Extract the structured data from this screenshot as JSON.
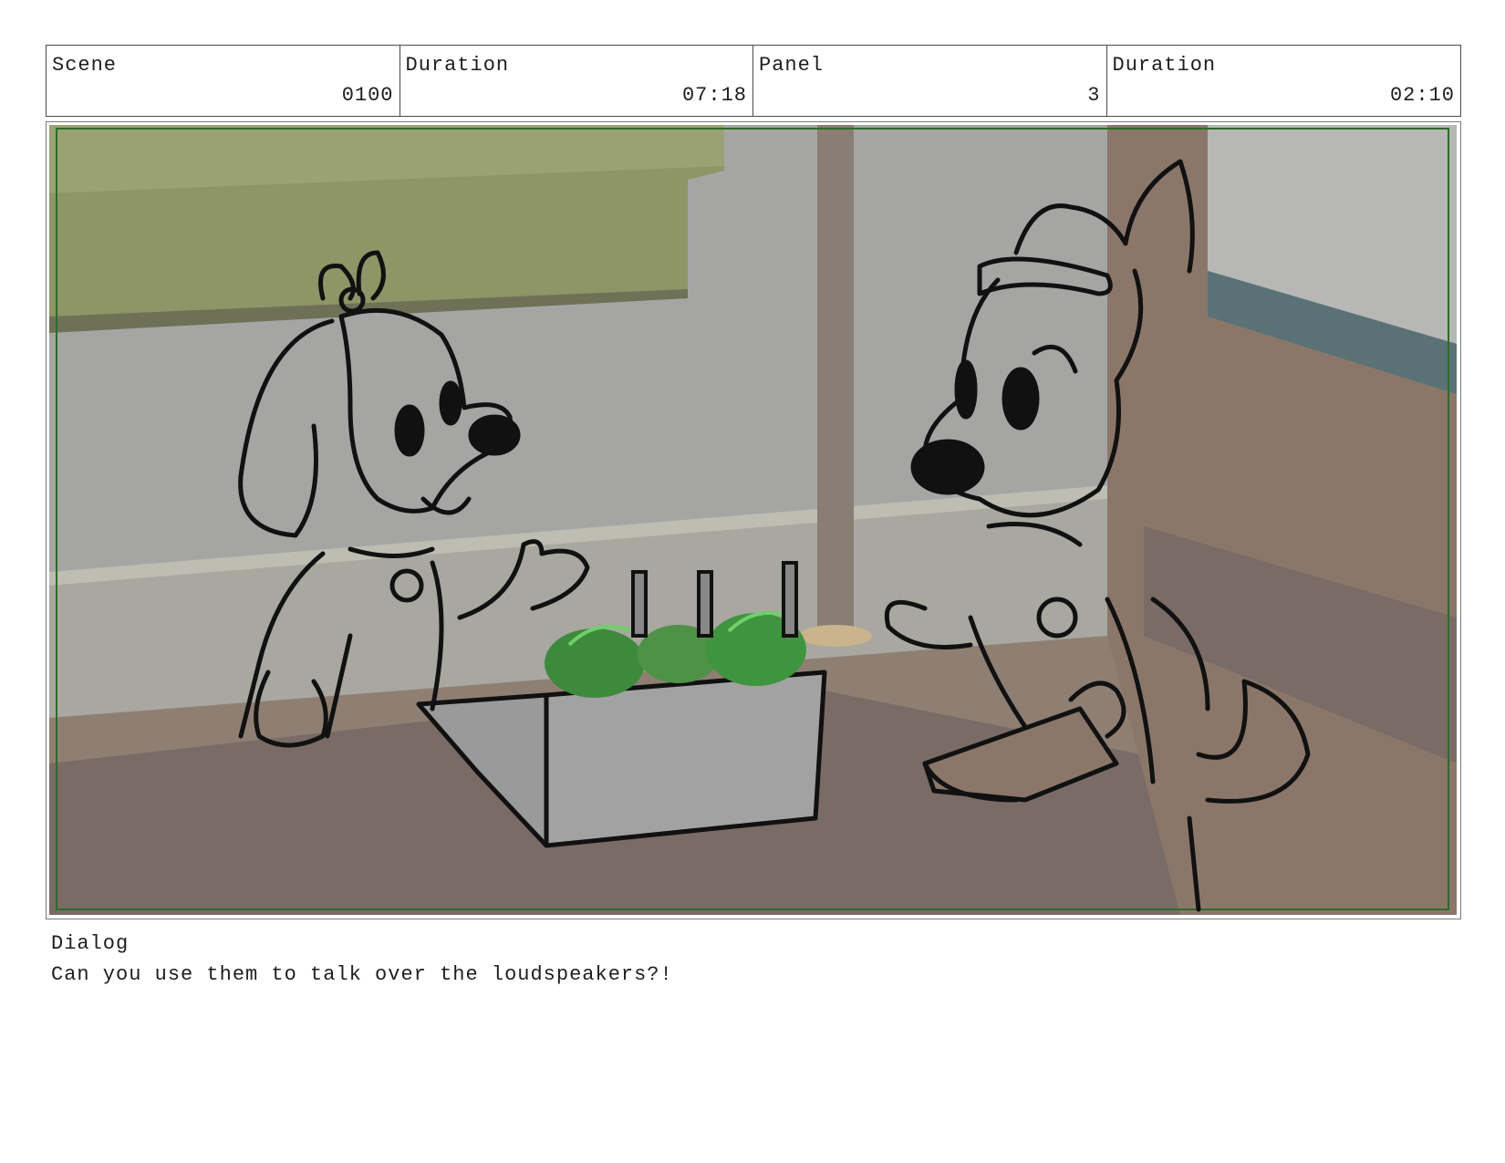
{
  "header": {
    "scene_label": "Scene",
    "scene_value": "0100",
    "scene_duration_label": "Duration",
    "scene_duration_value": "07:18",
    "panel_label": "Panel",
    "panel_value": "3",
    "panel_duration_label": "Duration",
    "panel_duration_value": "02:10"
  },
  "dialog": {
    "label": "Dialog",
    "text": "Can you use them to talk over the loudspeakers?!"
  }
}
